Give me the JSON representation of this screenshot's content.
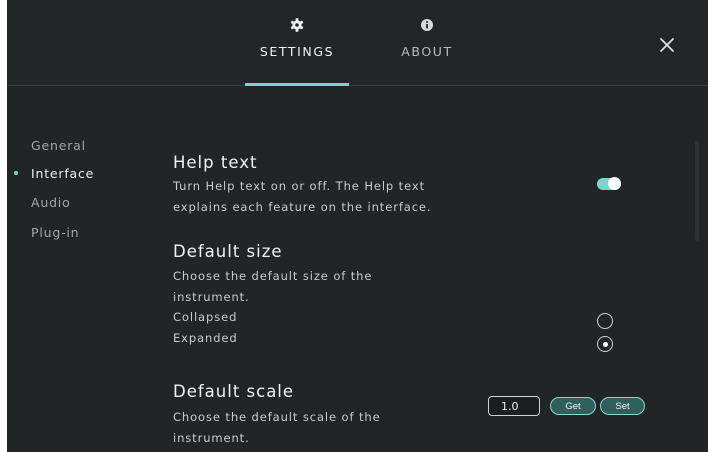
{
  "tabs": {
    "settings": {
      "label": "SETTINGS",
      "icon": "gear-icon",
      "active": true
    },
    "about": {
      "label": "ABOUT",
      "icon": "info-icon",
      "active": false
    }
  },
  "sidebar": {
    "items": [
      {
        "label": "General",
        "active": false
      },
      {
        "label": "Interface",
        "active": true
      },
      {
        "label": "Audio",
        "active": false
      },
      {
        "label": "Plug-in",
        "active": false
      }
    ]
  },
  "sections": {
    "help_text": {
      "title": "Help text",
      "desc_line1": "Turn Help text on or off. The Help text",
      "desc_line2": "explains each feature on the interface.",
      "enabled": true
    },
    "default_size": {
      "title": "Default size",
      "desc_line1": "Choose the default size of the",
      "desc_line2": "instrument.",
      "options": [
        {
          "label": "Collapsed",
          "selected": false
        },
        {
          "label": "Expanded",
          "selected": true
        }
      ]
    },
    "default_scale": {
      "title": "Default scale",
      "desc_line1": "Choose the default scale of the",
      "desc_line2": "instrument.",
      "value": "1.0",
      "get_label": "Get",
      "set_label": "Set"
    }
  },
  "colors": {
    "background": "#222526",
    "accent": "#7fd3cf",
    "button_fill": "#2f5f5b"
  }
}
